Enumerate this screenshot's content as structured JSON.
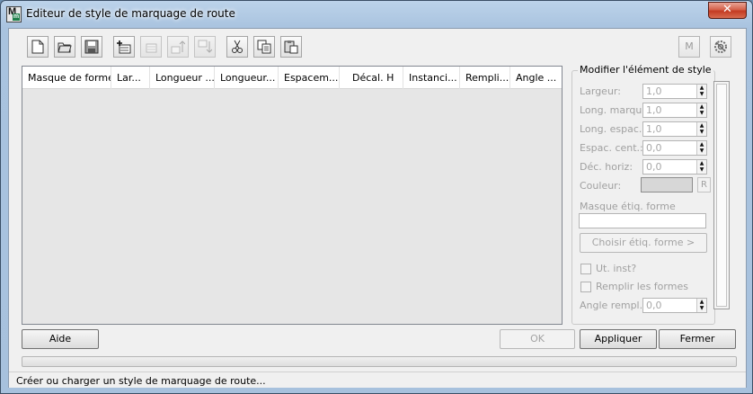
{
  "window": {
    "title": "Editeur de style de marquage de route",
    "icon": "max-app-icon",
    "close_glyph": "✕"
  },
  "toolbar": {
    "items": [
      {
        "name": "new-icon",
        "enabled": true
      },
      {
        "name": "open-folder-icon",
        "enabled": true
      },
      {
        "name": "save-icon",
        "enabled": true
      },
      {
        "name": "add-element-icon",
        "enabled": true
      },
      {
        "name": "remove-element-icon",
        "enabled": false
      },
      {
        "name": "move-up-icon",
        "enabled": false
      },
      {
        "name": "move-down-icon",
        "enabled": false
      },
      {
        "name": "cut-icon",
        "enabled": true
      },
      {
        "name": "copy-icon",
        "enabled": true
      },
      {
        "name": "paste-icon",
        "enabled": true
      }
    ],
    "right_m_label": "M",
    "right_settings_icon": "settings-icon"
  },
  "table": {
    "columns": [
      "Masque de forme",
      "Lar...",
      "Longueur ...",
      "Longueur...",
      "Espacem...",
      "Décal. H",
      "Instanci...",
      "Rempli...",
      "Angle ..."
    ],
    "rows": []
  },
  "style_panel": {
    "title": "Modifier l'élément de style",
    "fields": [
      {
        "label": "Largeur:",
        "value": "1,0"
      },
      {
        "label": "Long. marque:",
        "value": "1,0"
      },
      {
        "label": "Long. espac.:",
        "value": "1,0"
      },
      {
        "label": "Espac. cent.:",
        "value": "0,0"
      },
      {
        "label": "Déc. horiz:",
        "value": "0,0"
      }
    ],
    "color_label": "Couleur:",
    "color_value": "#d7d7d7",
    "color_reset_label": "R",
    "mask_label": "Masque étiq. forme",
    "mask_value": "",
    "choose_mask_button": "Choisir étiq. forme >",
    "use_instance_label": "Ut. inst?",
    "fill_shapes_label": "Remplir les formes",
    "fill_angle_label": "Angle rempl.:",
    "fill_angle_value": "0,0"
  },
  "buttons": {
    "help": "Aide",
    "ok": "OK",
    "apply": "Appliquer",
    "close": "Fermer"
  },
  "status": {
    "text": "Créer ou charger un style de marquage de route..."
  }
}
